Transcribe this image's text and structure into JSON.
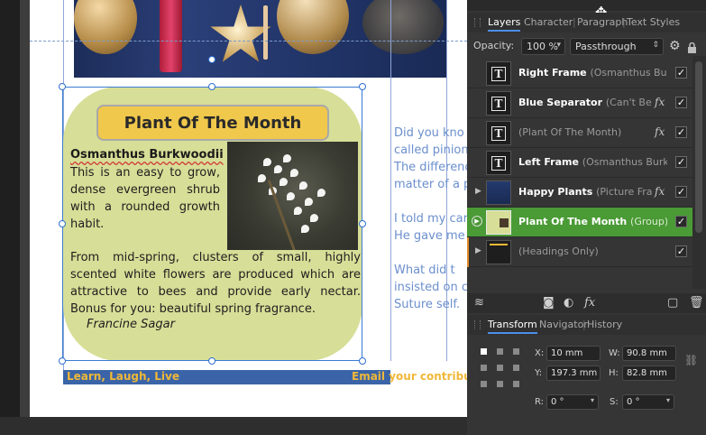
{
  "document": {
    "plant_title": "Plant Of The Month",
    "plant_name": "Osmanthus Burkwoodii",
    "plant_para1": "This is an easy to grow, dense evergreen shrub with a rounded growth habit.",
    "plant_para2": "From mid-spring, clusters of small, highly scented white flowers are produced which are attractive to bees and provide early nectar. Bonus for you:  beautiful spring fragrance.",
    "plant_author": "Francine Sagar",
    "footer_left": "Learn, Laugh, Live",
    "footer_right": "Email your contribu",
    "right_col_lines": [
      "Did you kno",
      "called pinion",
      "The differenc",
      "matter of a p",
      "",
      "I told my car",
      "He gave me a",
      "",
      "What did t",
      "insisted on c",
      "Suture self."
    ]
  },
  "panel": {
    "tabs": [
      {
        "label": "Layers",
        "active": true
      },
      {
        "label": "Character",
        "active": false
      },
      {
        "label": "Paragraph",
        "active": false
      },
      {
        "label": "Text Styles",
        "active": false
      }
    ],
    "opacity_label": "Opacity:",
    "opacity_value": "100 %",
    "blend_mode": "Passthrough",
    "layers": [
      {
        "name": "Right Frame",
        "detail": "(Osmanthus Burkwoo",
        "fx": false,
        "checked": true,
        "type": "text",
        "expand": false,
        "selected": false
      },
      {
        "name": "Blue Separator",
        "detail": "(Can't Beat A",
        "fx": true,
        "checked": true,
        "type": "text",
        "expand": false,
        "selected": false
      },
      {
        "name": "",
        "detail": "(Plant Of The Month)",
        "fx": true,
        "checked": true,
        "type": "text",
        "expand": false,
        "selected": false
      },
      {
        "name": "Left Frame",
        "detail": "(Osmanthus Burkwoo",
        "fx": false,
        "checked": true,
        "type": "text",
        "expand": false,
        "selected": false
      },
      {
        "name": "Happy Plants",
        "detail": "(Picture Frame)",
        "fx": true,
        "checked": true,
        "type": "picture",
        "expand": true,
        "selected": false
      },
      {
        "name": "Plant Of The Month",
        "detail": "(Group)",
        "fx": false,
        "checked": true,
        "type": "group",
        "expand": true,
        "selected": true
      },
      {
        "name": "",
        "detail": "(Headings Only)",
        "fx": false,
        "checked": true,
        "type": "picture",
        "expand": true,
        "selected": false
      }
    ],
    "fx_glyph": "fx",
    "check_glyph": "✓",
    "transform_tabs": [
      {
        "label": "Transform",
        "active": true
      },
      {
        "label": "Navigator",
        "active": false
      },
      {
        "label": "History",
        "active": false
      }
    ],
    "transform": {
      "x_label": "X:",
      "x": "10 mm",
      "y_label": "Y:",
      "y": "197.3 mm",
      "w_label": "W:",
      "w": "90.8 mm",
      "h_label": "H:",
      "h": "82.8 mm",
      "r_label": "R:",
      "r": "0 °",
      "s_label": "S:",
      "s": "0 °"
    }
  },
  "colors": {
    "accent": "#4d8fe8",
    "selected_layer": "#4a9a35",
    "plant_bg": "#d7de97",
    "title_bg": "#f0c84b",
    "footer_band": "#3a64a7",
    "footer_text": "#f0b838",
    "right_text": "#6b8fcc"
  },
  "icons": {
    "move_cursor": "move-cursor-icon",
    "settings": "gear-icon",
    "lock": "lock-icon",
    "layers_panel": "layers-stack-icon",
    "mask": "mask-icon",
    "adjustment": "adjustment-icon",
    "fx": "fx-icon",
    "add_layer": "add-layer-icon",
    "delete": "trash-icon",
    "link": "link-icon"
  }
}
